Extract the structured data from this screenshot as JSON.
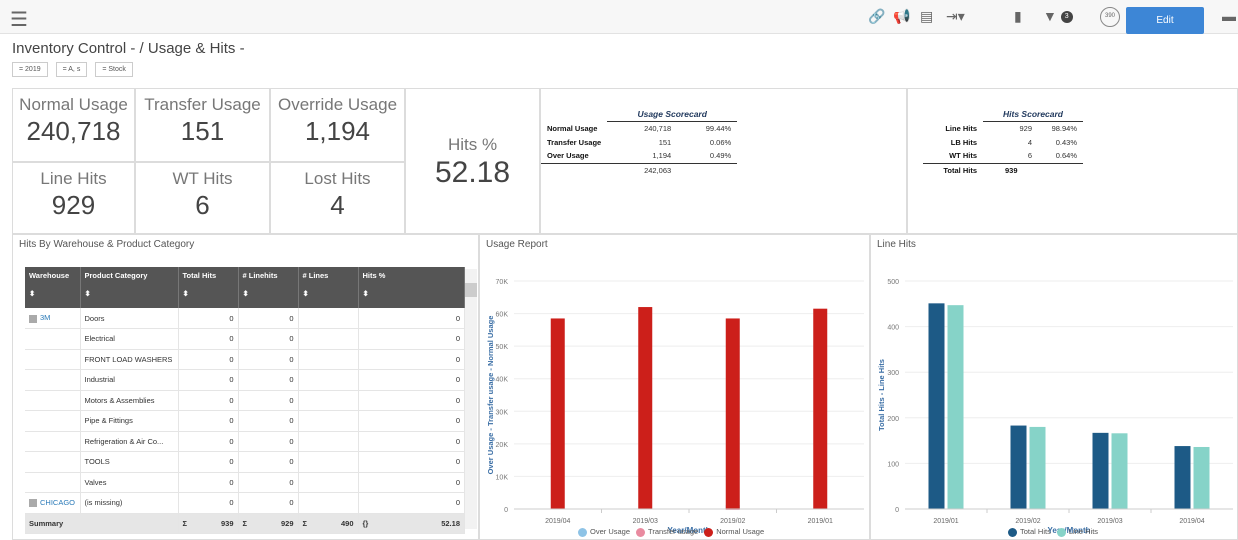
{
  "breadcrumb": {
    "text": "Inventory Control -  /  Usage & Hits -"
  },
  "filters": [
    "= 2019",
    "= A, s",
    "= Stock"
  ],
  "toolbar": {
    "edit_label": "Edit",
    "filter_count": "3",
    "history_label": "390"
  },
  "kpis": {
    "normal_usage": {
      "label": "Normal Usage",
      "value": "240,718"
    },
    "transfer_usage": {
      "label": "Transfer Usage",
      "value": "151"
    },
    "override_usage": {
      "label": "Override Usage",
      "value": "1,194"
    },
    "line_hits": {
      "label": "Line Hits",
      "value": "929"
    },
    "wt_hits": {
      "label": "WT Hits",
      "value": "6"
    },
    "lost_hits": {
      "label": "Lost Hits",
      "value": "4"
    },
    "hits_pct": {
      "label": "Hits %",
      "value": "52.18"
    }
  },
  "usage_scorecard": {
    "title": "Usage Scorecard",
    "rows": [
      {
        "label": "Normal Usage",
        "value": "240,718",
        "pct": "99.44%"
      },
      {
        "label": "Transfer Usage",
        "value": "151",
        "pct": "0.06%"
      },
      {
        "label": "Over Usage",
        "value": "1,194",
        "pct": "0.49%"
      }
    ],
    "total": "242,063"
  },
  "hits_scorecard": {
    "title": "Hits Scorecard",
    "rows": [
      {
        "label": "Line Hits",
        "value": "929",
        "pct": "98.94%"
      },
      {
        "label": "LB Hits",
        "value": "4",
        "pct": "0.43%"
      },
      {
        "label": "WT Hits",
        "value": "6",
        "pct": "0.64%"
      }
    ],
    "total_label": "Total Hits",
    "total": "939"
  },
  "hits_table": {
    "title": "Hits By Warehouse & Product Category",
    "columns": [
      "Warehouse",
      "Product Category",
      "Total Hits",
      "# Linehits",
      "# Lines",
      "Hits %"
    ],
    "rows": [
      {
        "wh": "3M",
        "cat": "Doors",
        "th": "0",
        "lh": "0",
        "ln": "",
        "pct": "0"
      },
      {
        "wh": "",
        "cat": "Electrical",
        "th": "0",
        "lh": "0",
        "ln": "",
        "pct": "0"
      },
      {
        "wh": "",
        "cat": "FRONT LOAD WASHERS",
        "th": "0",
        "lh": "0",
        "ln": "",
        "pct": "0"
      },
      {
        "wh": "",
        "cat": "Industrial",
        "th": "0",
        "lh": "0",
        "ln": "",
        "pct": "0"
      },
      {
        "wh": "",
        "cat": "Motors & Assemblies",
        "th": "0",
        "lh": "0",
        "ln": "",
        "pct": "0"
      },
      {
        "wh": "",
        "cat": "Pipe & Fittings",
        "th": "0",
        "lh": "0",
        "ln": "",
        "pct": "0"
      },
      {
        "wh": "",
        "cat": "Refrigeration & Air Co...",
        "th": "0",
        "lh": "0",
        "ln": "",
        "pct": "0"
      },
      {
        "wh": "",
        "cat": "TOOLS",
        "th": "0",
        "lh": "0",
        "ln": "",
        "pct": "0"
      },
      {
        "wh": "",
        "cat": "Valves",
        "th": "0",
        "lh": "0",
        "ln": "",
        "pct": "0"
      },
      {
        "wh": "CHICAGO",
        "cat": "(is missing)",
        "th": "0",
        "lh": "0",
        "ln": "",
        "pct": "0"
      }
    ],
    "summary": {
      "label": "Summary",
      "sigma": "Σ",
      "total_hits": "939",
      "linehits": "929",
      "lines": "490",
      "braces": "{}",
      "pct": "52.18"
    }
  },
  "chart_data": [
    {
      "type": "bar",
      "panel_title": "Usage Report",
      "categories": [
        "2019/04",
        "2019/03",
        "2019/02",
        "2019/01"
      ],
      "series": [
        {
          "name": "Over Usage",
          "color": "#8ec3e6",
          "values": [
            0,
            0,
            1194,
            0
          ]
        },
        {
          "name": "Transfer usage",
          "color": "#e98ba0",
          "values": [
            0,
            0,
            151,
            0
          ]
        },
        {
          "name": "Normal Usage",
          "color": "#cc1f1a",
          "values": [
            58500,
            62000,
            58500,
            61500
          ]
        }
      ],
      "xlabel": "Year/Month",
      "ylabel": "Over Usage - Transfer usage - Normal Usage",
      "ylim": [
        0,
        70000
      ],
      "yticks": [
        "0",
        "10K",
        "20K",
        "30K",
        "40K",
        "50K",
        "60K",
        "70K"
      ],
      "legend": "bottom"
    },
    {
      "type": "bar",
      "panel_title": "Line Hits",
      "categories": [
        "2019/01",
        "2019/02",
        "2019/03",
        "2019/04"
      ],
      "series": [
        {
          "name": "Total Hits",
          "color": "#1d5a86",
          "values": [
            451,
            183,
            167,
            138
          ]
        },
        {
          "name": "Line Hits",
          "color": "#86d3c8",
          "values": [
            447,
            180,
            166,
            136
          ]
        }
      ],
      "xlabel": "Year/Month",
      "ylabel": "Total Hits - Line Hits",
      "ylim": [
        0,
        500
      ],
      "yticks": [
        "0",
        "100",
        "200",
        "300",
        "400",
        "500"
      ],
      "legend": "bottom"
    }
  ]
}
